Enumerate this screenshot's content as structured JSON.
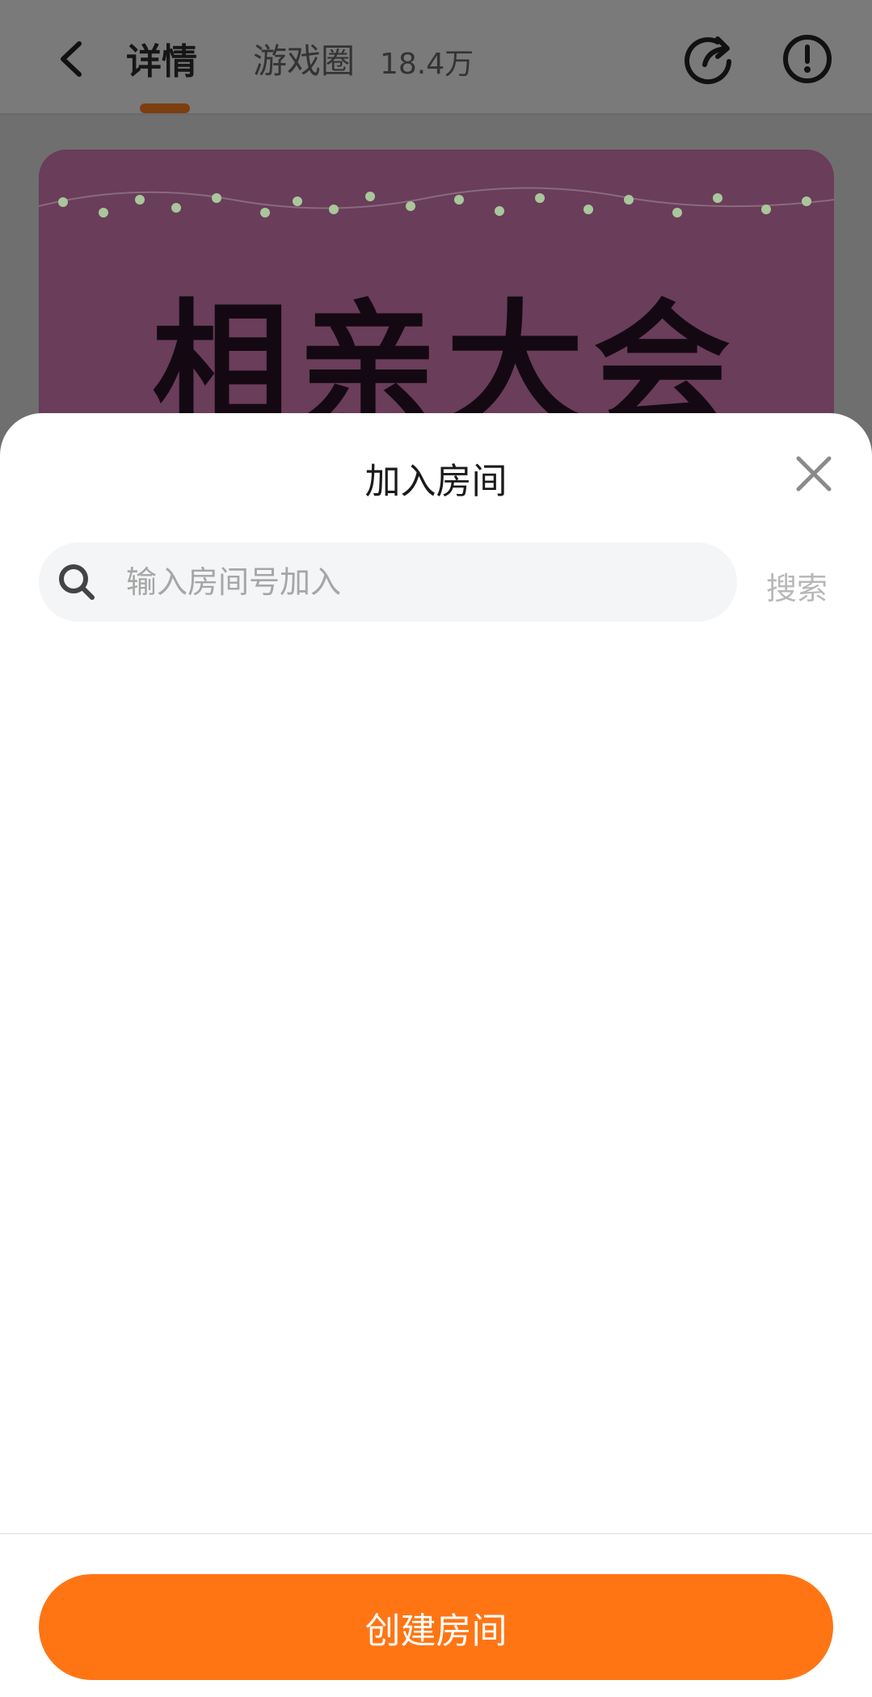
{
  "header": {
    "tab_detail": "详情",
    "tab_circle": "游戏圈",
    "circle_count": "18.4万",
    "accent_color": "#ff7514"
  },
  "banner": {
    "title": "相亲大会"
  },
  "sheet": {
    "title": "加入房间",
    "search_placeholder": "输入房间号加入",
    "search_value": "",
    "search_button": "搜索",
    "create_button": "创建房间"
  },
  "icons": {
    "back": "chevron-left-icon",
    "share": "share-icon",
    "report": "exclamation-circle-icon",
    "close": "close-icon",
    "search": "search-icon"
  }
}
